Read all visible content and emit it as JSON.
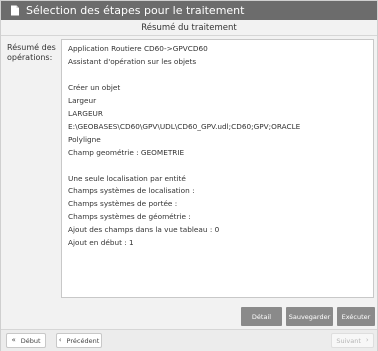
{
  "window": {
    "title": "Sélection des étapes pour le traitement",
    "title_icon": "document-icon"
  },
  "section": {
    "header": "Résumé du traitement"
  },
  "summary": {
    "label_line1": "Résumé des",
    "label_line2": "opérations:",
    "lines": [
      "Application Routiere CD60->GPVCD60",
      "Assistant d'opération sur les objets",
      "",
      "Créer un objet",
      "Largeur",
      "LARGEUR",
      "E:\\GEOBASES\\CD60\\GPV\\UDL\\CD60_GPV.udl;CD60;GPV;ORACLE",
      "Polyligne",
      "Champ geométrie : GEOMETRIE",
      "",
      "Une seule localisation par entité",
      "Champs systèmes de localisation :",
      "Champs systèmes de portée :",
      "Champs systèmes de géométrie :",
      "Ajout des champs dans la vue tableau : 0",
      "Ajout en début : 1"
    ]
  },
  "actions": {
    "detail": "Détail",
    "save": "Sauvegarder",
    "execute": "Exécuter"
  },
  "nav": {
    "first": "Début",
    "first_icon": "double-chevron-left-icon",
    "previous": "Précédent",
    "previous_icon": "chevron-left-icon",
    "next": "Suivant",
    "next_icon": "chevron-right-icon"
  }
}
